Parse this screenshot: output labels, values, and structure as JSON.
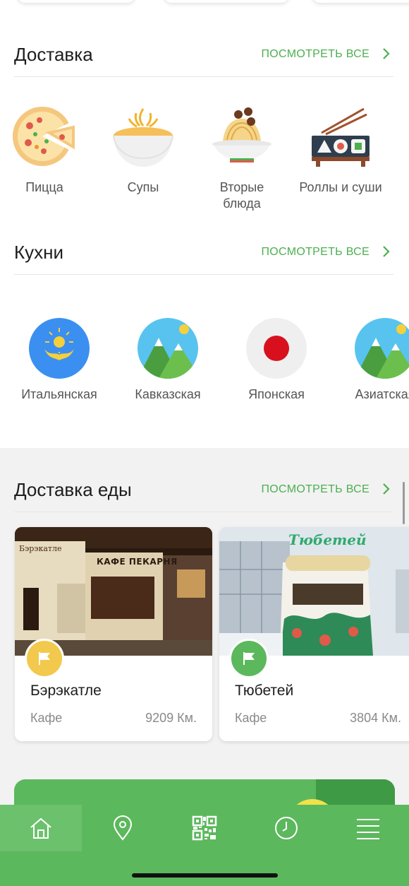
{
  "sections": {
    "delivery": {
      "title": "Доставка",
      "see_all": "ПОСМОТРЕТЬ ВСЕ"
    },
    "cuisines": {
      "title": "Кухни",
      "see_all": "ПОСМОТРЕТЬ ВСЕ"
    },
    "food_delivery": {
      "title": "Доставка еды",
      "see_all": "ПОСМОТРЕТЬ ВСЕ"
    }
  },
  "categories": [
    {
      "label": "Пицца",
      "icon": "pizza-icon"
    },
    {
      "label": "Супы",
      "icon": "soup-icon"
    },
    {
      "label": "Вторые\nблюда",
      "line1": "Вторые",
      "line2": "блюда",
      "icon": "pasta-icon"
    },
    {
      "label": "Роллы и суши",
      "icon": "sushi-icon"
    }
  ],
  "cuisines": [
    {
      "label": "Итальянская",
      "icon": "kazakhstan-flag-icon"
    },
    {
      "label": "Кавказская",
      "icon": "mountains-icon"
    },
    {
      "label": "Японская",
      "icon": "japan-flag-icon"
    },
    {
      "label": "Азиатская",
      "icon": "mountains-icon"
    }
  ],
  "restaurants": [
    {
      "name": "Бэрэкатле",
      "type": "Кафе",
      "distance": "9209 Км.",
      "badge_color": "#f2c94c",
      "photo_sign": "КАФЕ ПЕКАРНЯ",
      "photo_sign2": "Бэрэкатле"
    },
    {
      "name": "Тюбетей",
      "type": "Кафе",
      "distance": "3804 Км.",
      "badge_color": "#5cb85c",
      "photo_sign": "Тюбетей"
    }
  ],
  "tabbar": [
    {
      "icon": "home-icon",
      "active": true
    },
    {
      "icon": "map-pin-icon",
      "active": false
    },
    {
      "icon": "qr-code-icon",
      "active": false
    },
    {
      "icon": "clock-icon",
      "active": false
    },
    {
      "icon": "menu-icon",
      "active": false
    }
  ],
  "colors": {
    "accent": "#4caf50",
    "tabbar": "#5cb85c",
    "badge_yellow": "#f2c94c"
  }
}
